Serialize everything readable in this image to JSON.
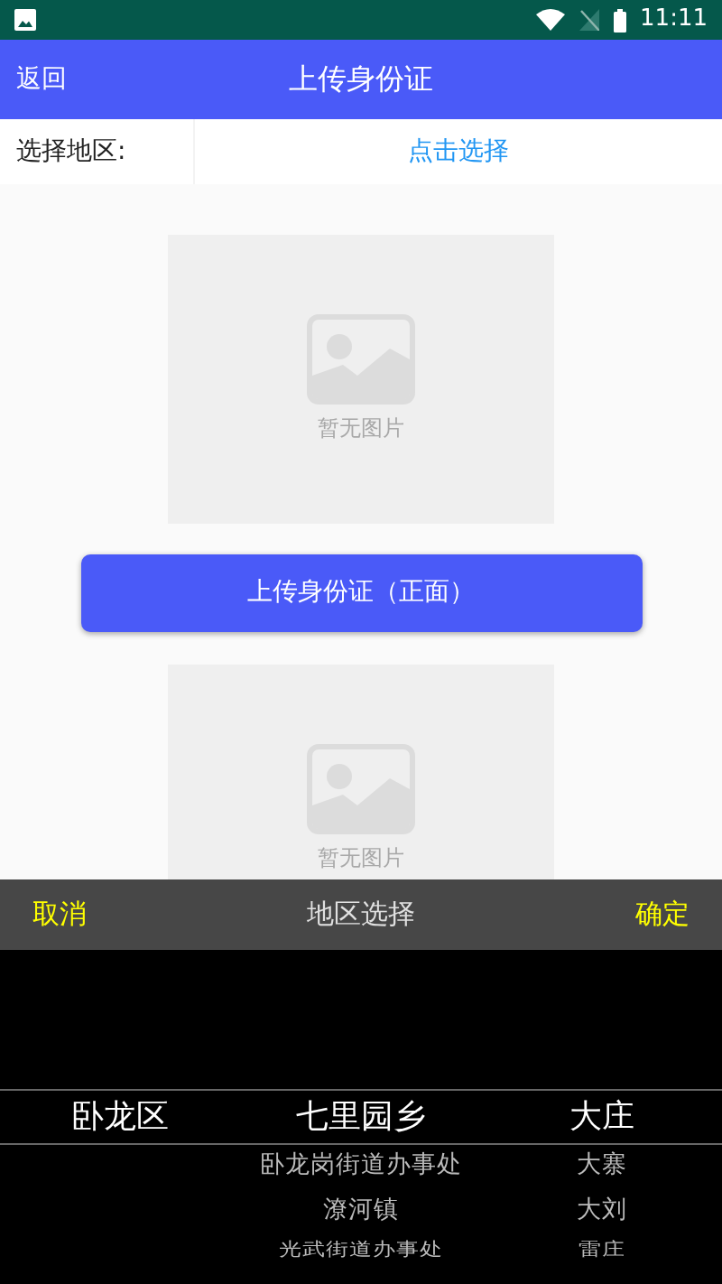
{
  "status_bar": {
    "time": "11:11"
  },
  "header": {
    "back": "返回",
    "title": "上传身份证"
  },
  "region_row": {
    "label": "选择地区:",
    "action": "点击选择"
  },
  "uploads": [
    {
      "placeholder": "暂无图片",
      "button": "上传身份证（正面）"
    },
    {
      "placeholder": "暂无图片"
    }
  ],
  "picker": {
    "cancel": "取消",
    "title": "地区选择",
    "confirm": "确定",
    "columns": [
      {
        "items": [
          {
            "label": "卧龙区",
            "selected": true
          }
        ]
      },
      {
        "items": [
          {
            "label": "七里园乡",
            "selected": true
          },
          {
            "label": "卧龙岗街道办事处",
            "selected": false
          },
          {
            "label": "潦河镇",
            "selected": false
          },
          {
            "label": "光武街道办事处",
            "selected": false
          }
        ]
      },
      {
        "items": [
          {
            "label": "大庄",
            "selected": true
          },
          {
            "label": "大寨",
            "selected": false
          },
          {
            "label": "大刘",
            "selected": false
          },
          {
            "label": "雷庄",
            "selected": false
          }
        ]
      }
    ]
  }
}
